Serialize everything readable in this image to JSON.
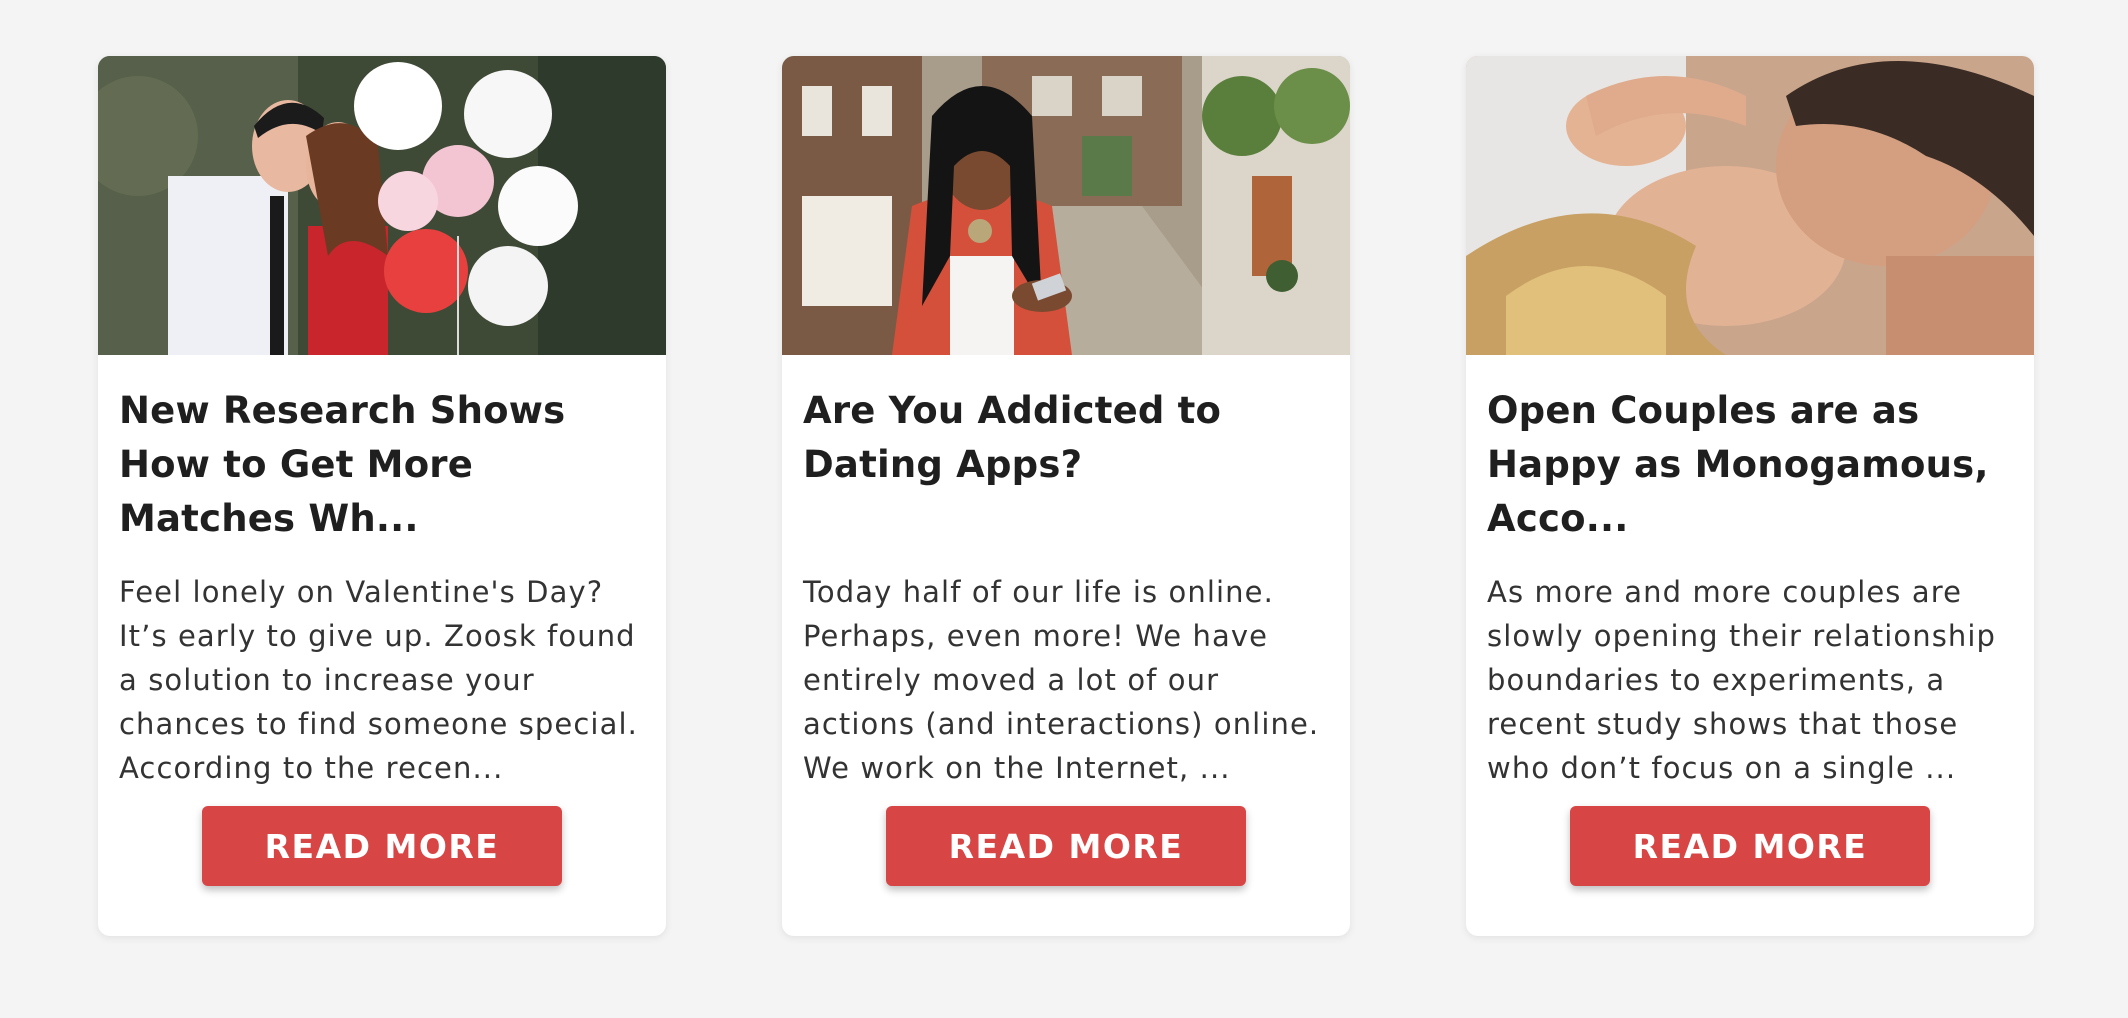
{
  "articles": [
    {
      "title": "New Research Shows How to Get More Matches Wh...",
      "excerpt": "Feel lonely on Valentine's Day? It’s early to give up. Zoosk found a solution to increase your chances to find someone special. According to the recen...",
      "button_label": "READ MORE"
    },
    {
      "title": "Are You Addicted to Dating Apps?",
      "excerpt": "Today half of our life is online. Perhaps, even more! We have entirely moved a lot of our actions (and interactions) online. We work on the Internet, ...",
      "button_label": "READ MORE"
    },
    {
      "title": "Open Couples are as Happy as Monogamous, Acco...",
      "excerpt": "As more and more couples are slowly opening their relationship boundaries to experiments, a recent study shows that those who don’t focus on a single ...",
      "button_label": "READ MORE"
    }
  ],
  "colors": {
    "page_background": "#f4f4f4",
    "card_background": "#ffffff",
    "button": "#d84545",
    "title_text": "#1f1f1f"
  }
}
